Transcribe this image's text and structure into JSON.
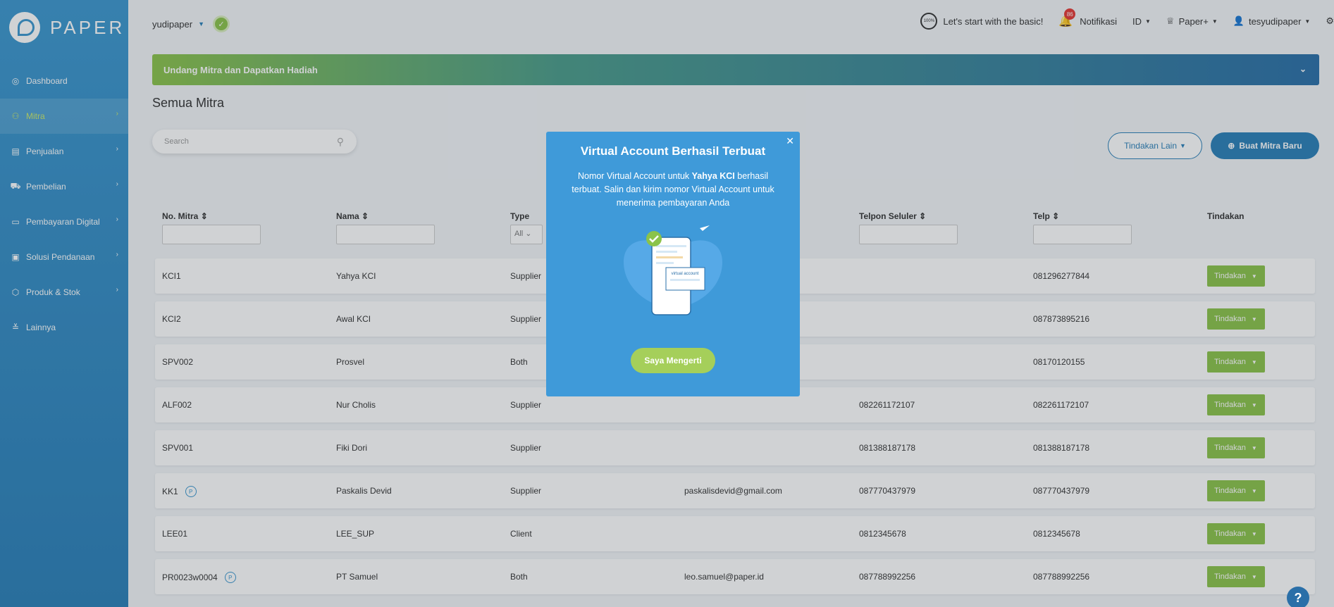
{
  "brand": "PAPER",
  "sidebar": {
    "items": [
      {
        "label": "Dashboard",
        "icon": "dashboard-icon"
      },
      {
        "label": "Mitra",
        "icon": "users-icon",
        "active": true
      },
      {
        "label": "Penjualan",
        "icon": "document-icon"
      },
      {
        "label": "Pembelian",
        "icon": "cart-icon"
      },
      {
        "label": "Pembayaran Digital",
        "icon": "card-icon"
      },
      {
        "label": "Solusi Pendanaan",
        "icon": "money-icon"
      },
      {
        "label": "Produk & Stok",
        "icon": "box-icon"
      },
      {
        "label": "Lainnya",
        "icon": "more-icon"
      }
    ]
  },
  "topbar": {
    "company": "yudipaper",
    "progress_label": "100%",
    "basic_link": "Let's start with the basic!",
    "notif_count": "86",
    "notif_label": "Notifikasi",
    "language": "ID",
    "paper_plus": "Paper+",
    "user": "tesyudipaper"
  },
  "banner": {
    "text": "Undang Mitra dan Dapatkan Hadiah"
  },
  "page": {
    "title": "Semua Mitra",
    "search_placeholder": "Search",
    "btn_other": "Tindakan Lain",
    "btn_new": "Buat Mitra Baru"
  },
  "table": {
    "headers": {
      "no": "No. Mitra",
      "name": "Nama",
      "type": "Type",
      "type_filter": "All",
      "phone_mobile": "Telpon Seluler",
      "phone": "Telp",
      "action": "Tindakan"
    },
    "rows": [
      {
        "no": "KCI1",
        "name": "Yahya KCI",
        "type": "Supplier",
        "email": "",
        "mobile": "",
        "phone": "081296277844",
        "paper": false
      },
      {
        "no": "KCI2",
        "name": "Awal KCI",
        "type": "Supplier",
        "email": "",
        "mobile": "",
        "phone": "087873895216",
        "paper": false
      },
      {
        "no": "SPV002",
        "name": "Prosvel",
        "type": "Both",
        "email": "",
        "mobile": "",
        "phone": "08170120155",
        "paper": false
      },
      {
        "no": "ALF002",
        "name": "Nur Cholis",
        "type": "Supplier",
        "email": "",
        "mobile": "082261172107",
        "phone": "082261172107",
        "paper": false
      },
      {
        "no": "SPV001",
        "name": "Fiki Dori",
        "type": "Supplier",
        "email": "",
        "mobile": "081388187178",
        "phone": "081388187178",
        "paper": false
      },
      {
        "no": "KK1",
        "name": "Paskalis Devid",
        "type": "Supplier",
        "email": "paskalisdevid@gmail.com",
        "mobile": "087770437979",
        "phone": "087770437979",
        "paper": true
      },
      {
        "no": "LEE01",
        "name": "LEE_SUP",
        "type": "Client",
        "email": "",
        "mobile": "0812345678",
        "phone": "0812345678",
        "paper": false
      },
      {
        "no": "PR0023w0004",
        "name": "PT Samuel",
        "type": "Both",
        "email": "leo.samuel@paper.id",
        "mobile": "087788992256",
        "phone": "087788992256",
        "paper": true
      }
    ],
    "action_label": "Tindakan"
  },
  "modal": {
    "title": "Virtual Account Berhasil Terbuat",
    "body_pre": "Nomor Virtual Account untuk ",
    "body_name": "Yahya KCI",
    "body_post": " berhasil terbuat. Salin dan kirim nomor Virtual Account untuk menerima pembayaran Anda",
    "button": "Saya Mengerti",
    "illus_label": "virtual account"
  },
  "colors": {
    "primary": "#2a7fb8",
    "accent_green": "#8bc34a",
    "modal_bg": "#3f9ad9"
  }
}
